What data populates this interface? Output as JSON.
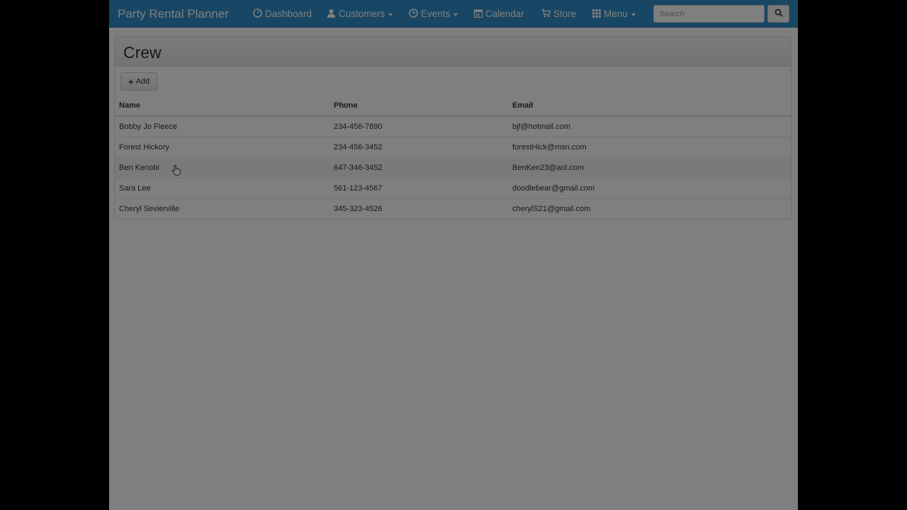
{
  "navbar": {
    "brand": "Party Rental Planner",
    "items": [
      {
        "label": "Dashboard",
        "icon": "dashboard-icon",
        "dropdown": false
      },
      {
        "label": "Customers",
        "icon": "user-icon",
        "dropdown": true
      },
      {
        "label": "Events",
        "icon": "clock-icon",
        "dropdown": true
      },
      {
        "label": "Calendar",
        "icon": "calendar-icon",
        "dropdown": false
      },
      {
        "label": "Store",
        "icon": "cart-icon",
        "dropdown": false
      },
      {
        "label": "Menu",
        "icon": "grid-icon",
        "dropdown": true
      }
    ],
    "search_placeholder": "Search"
  },
  "page": {
    "title": "Crew",
    "add_label": "Add"
  },
  "table": {
    "columns": [
      "Name",
      "Phone",
      "Email"
    ],
    "rows": [
      {
        "name": "Bobby Jo Fleece",
        "phone": "234-456-7890",
        "email": "bjf@hotmail.com"
      },
      {
        "name": "Forest Hickory",
        "phone": "234-456-3452",
        "email": "forestHick@msn.com"
      },
      {
        "name": "Ben Kenobi",
        "phone": "647-346-3452",
        "email": "BenKen23@aol.com"
      },
      {
        "name": "Sara Lee",
        "phone": "561-123-4567",
        "email": "doodlebear@gmail.com"
      },
      {
        "name": "Cheryl Sevierville",
        "phone": "345-323-4526",
        "email": "cherylS21@gmail.com"
      }
    ]
  },
  "colors": {
    "navbar": "#2e8ec9",
    "overlay": "rgba(0,0,0,0.5)"
  }
}
